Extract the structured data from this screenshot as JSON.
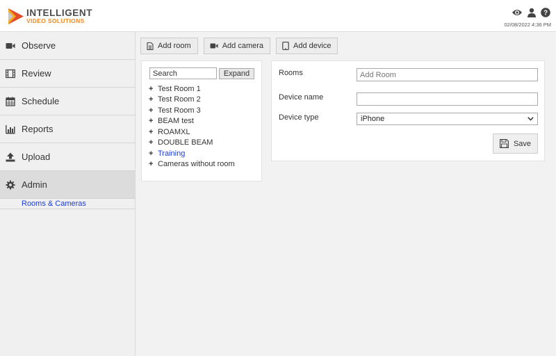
{
  "brand": {
    "line1": "INTELLIGENT",
    "line2": "VIDEO SOLUTIONS"
  },
  "header": {
    "icons": [
      "eye-icon",
      "user-icon",
      "help-icon"
    ],
    "timestamp": "02/08/2022 4:36 PM"
  },
  "sidebar": {
    "items": [
      {
        "label": "Observe",
        "icon": "video-camera-icon"
      },
      {
        "label": "Review",
        "icon": "film-icon"
      },
      {
        "label": "Schedule",
        "icon": "calendar-icon"
      },
      {
        "label": "Reports",
        "icon": "bar-chart-icon"
      },
      {
        "label": "Upload",
        "icon": "upload-icon"
      },
      {
        "label": "Admin",
        "icon": "gear-icon",
        "active": true
      }
    ],
    "sub_item": "Rooms & Cameras"
  },
  "toolbar": {
    "add_room": "Add room",
    "add_camera": "Add camera",
    "add_device": "Add device"
  },
  "tree": {
    "search_placeholder": "Search",
    "expand_label": "Expand",
    "items": [
      {
        "label": "Test Room 1"
      },
      {
        "label": "Test Room 2"
      },
      {
        "label": "Test Room 3"
      },
      {
        "label": "BEAM test"
      },
      {
        "label": "ROAMXL"
      },
      {
        "label": "DOUBLE BEAM"
      },
      {
        "label": "Training",
        "link": true
      },
      {
        "label": "Cameras without room"
      }
    ]
  },
  "form": {
    "rooms_label": "Rooms",
    "rooms_placeholder": "Add Room",
    "device_name_label": "Device name",
    "device_name_value": "",
    "device_type_label": "Device type",
    "device_type_value": "iPhone",
    "save_label": "Save"
  },
  "colors": {
    "accent_orange": "#f08a24",
    "link_blue": "#1a3bd6",
    "active_nav_bg": "#dcdcdc"
  }
}
